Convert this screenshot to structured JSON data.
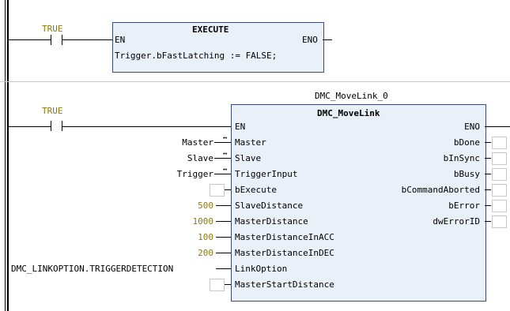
{
  "rung1": {
    "contact_label": "TRUE",
    "block": {
      "title": "EXECUTE",
      "en": "EN",
      "eno": "ENO",
      "code": "Trigger.bFastLatching := FALSE;"
    }
  },
  "rung2": {
    "contact_label": "TRUE",
    "instance_name": "DMC_MoveLink_0",
    "block_type": "DMC_MoveLink",
    "inputs": {
      "en": "EN",
      "master": "Master",
      "slave": "Slave",
      "trigger_input": "TriggerInput",
      "bexecute": "bExecute",
      "slave_distance": "SlaveDistance",
      "master_distance": "MasterDistance",
      "master_distance_acc": "MasterDistanceInACC",
      "master_distance_dec": "MasterDistanceInDEC",
      "link_option": "LinkOption",
      "master_start_distance": "MasterStartDistance"
    },
    "outputs": {
      "eno": "ENO",
      "bdone": "bDone",
      "binsync": "bInSync",
      "bbusy": "bBusy",
      "bcommandaborted": "bCommandAborted",
      "berror": "bError",
      "dwerrorid": "dwErrorID"
    },
    "input_values": {
      "master": "Master",
      "slave": "Slave",
      "trigger": "Trigger",
      "slave_distance": "500",
      "master_distance": "1000",
      "master_distance_acc": "100",
      "master_distance_dec": "200",
      "link_option": "DMC_LINKOPTION.TRIGGERDETECTION"
    },
    "inout_arrow": "↔"
  },
  "colors": {
    "constant": "#8a7a12",
    "block_fill": "#eaf0f8",
    "block_border": "#3a4a7a"
  }
}
